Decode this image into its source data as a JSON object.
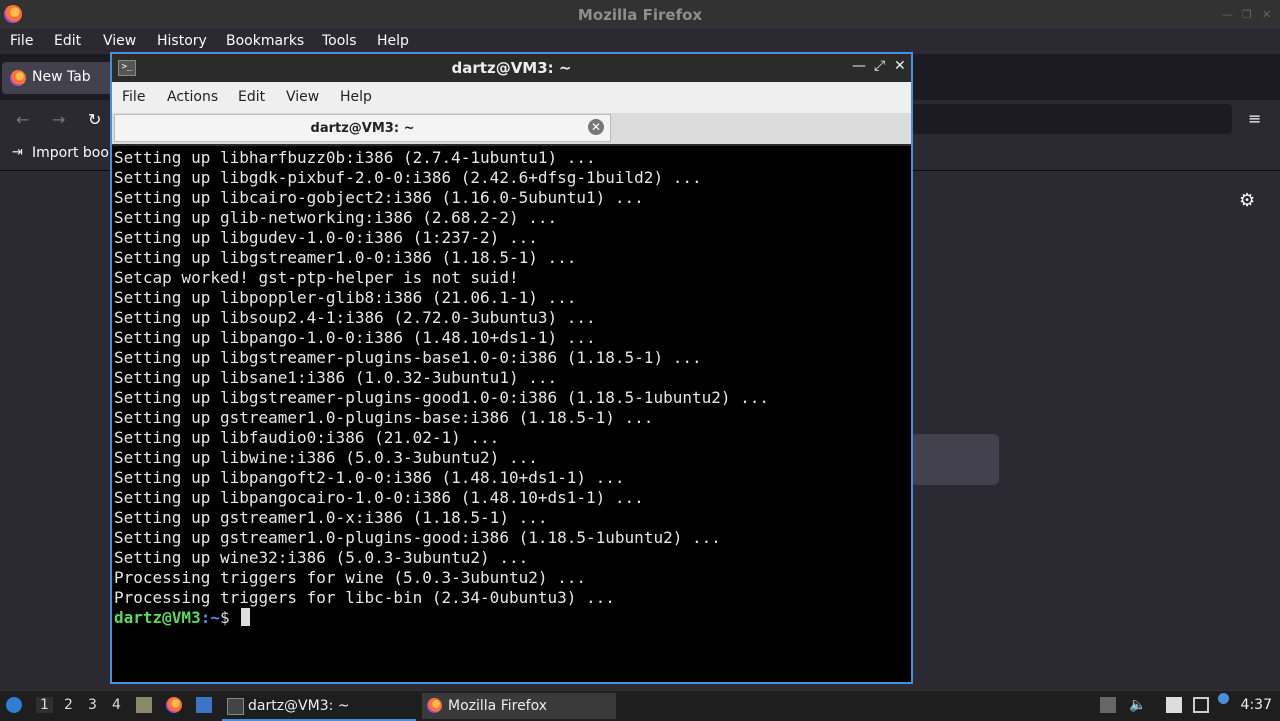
{
  "firefox": {
    "window_title": "Mozilla Firefox",
    "menu": [
      "File",
      "Edit",
      "View",
      "History",
      "Bookmarks",
      "Tools",
      "Help"
    ],
    "tab_label": "New Tab",
    "bookmarks_bar_item": "Import book"
  },
  "terminal": {
    "window_title": "dartz@VM3: ~",
    "menu": [
      "File",
      "Actions",
      "Edit",
      "View",
      "Help"
    ],
    "tab_label": "dartz@VM3: ~",
    "output_lines": [
      "Setting up libharfbuzz0b:i386 (2.7.4-1ubuntu1) ...",
      "Setting up libgdk-pixbuf-2.0-0:i386 (2.42.6+dfsg-1build2) ...",
      "Setting up libcairo-gobject2:i386 (1.16.0-5ubuntu1) ...",
      "Setting up glib-networking:i386 (2.68.2-2) ...",
      "Setting up libgudev-1.0-0:i386 (1:237-2) ...",
      "Setting up libgstreamer1.0-0:i386 (1.18.5-1) ...",
      "Setcap worked! gst-ptp-helper is not suid!",
      "Setting up libpoppler-glib8:i386 (21.06.1-1) ...",
      "Setting up libsoup2.4-1:i386 (2.72.0-3ubuntu3) ...",
      "Setting up libpango-1.0-0:i386 (1.48.10+ds1-1) ...",
      "Setting up libgstreamer-plugins-base1.0-0:i386 (1.18.5-1) ...",
      "Setting up libsane1:i386 (1.0.32-3ubuntu1) ...",
      "Setting up libgstreamer-plugins-good1.0-0:i386 (1.18.5-1ubuntu2) ...",
      "Setting up gstreamer1.0-plugins-base:i386 (1.18.5-1) ...",
      "Setting up libfaudio0:i386 (21.02-1) ...",
      "Setting up libwine:i386 (5.0.3-3ubuntu2) ...",
      "Setting up libpangoft2-1.0-0:i386 (1.48.10+ds1-1) ...",
      "Setting up libpangocairo-1.0-0:i386 (1.48.10+ds1-1) ...",
      "Setting up gstreamer1.0-x:i386 (1.18.5-1) ...",
      "Setting up gstreamer1.0-plugins-good:i386 (1.18.5-1ubuntu2) ...",
      "Setting up wine32:i386 (5.0.3-3ubuntu2) ...",
      "Processing triggers for wine (5.0.3-3ubuntu2) ...",
      "Processing triggers for libc-bin (2.34-0ubuntu3) ..."
    ],
    "prompt_user": "dartz@VM3",
    "prompt_path": ":~",
    "prompt_symbol": "$ "
  },
  "taskbar": {
    "workspaces": [
      "1",
      "2",
      "3",
      "4"
    ],
    "tasks": [
      "dartz@VM3: ~",
      "Mozilla Firefox"
    ],
    "clock": "4:37"
  },
  "colors": {
    "terminal_border": "#4a90d9",
    "prompt_user": "#5fd75f",
    "prompt_path": "#5f87ff"
  }
}
